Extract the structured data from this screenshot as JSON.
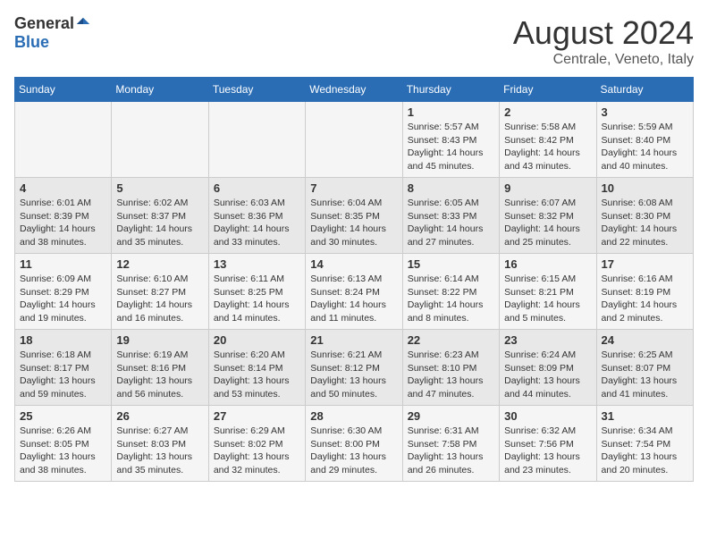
{
  "header": {
    "logo_general": "General",
    "logo_blue": "Blue",
    "month_year": "August 2024",
    "location": "Centrale, Veneto, Italy"
  },
  "calendar": {
    "days_of_week": [
      "Sunday",
      "Monday",
      "Tuesday",
      "Wednesday",
      "Thursday",
      "Friday",
      "Saturday"
    ],
    "weeks": [
      [
        {
          "day": "",
          "info": ""
        },
        {
          "day": "",
          "info": ""
        },
        {
          "day": "",
          "info": ""
        },
        {
          "day": "",
          "info": ""
        },
        {
          "day": "1",
          "info": "Sunrise: 5:57 AM\nSunset: 8:43 PM\nDaylight: 14 hours\nand 45 minutes."
        },
        {
          "day": "2",
          "info": "Sunrise: 5:58 AM\nSunset: 8:42 PM\nDaylight: 14 hours\nand 43 minutes."
        },
        {
          "day": "3",
          "info": "Sunrise: 5:59 AM\nSunset: 8:40 PM\nDaylight: 14 hours\nand 40 minutes."
        }
      ],
      [
        {
          "day": "4",
          "info": "Sunrise: 6:01 AM\nSunset: 8:39 PM\nDaylight: 14 hours\nand 38 minutes."
        },
        {
          "day": "5",
          "info": "Sunrise: 6:02 AM\nSunset: 8:37 PM\nDaylight: 14 hours\nand 35 minutes."
        },
        {
          "day": "6",
          "info": "Sunrise: 6:03 AM\nSunset: 8:36 PM\nDaylight: 14 hours\nand 33 minutes."
        },
        {
          "day": "7",
          "info": "Sunrise: 6:04 AM\nSunset: 8:35 PM\nDaylight: 14 hours\nand 30 minutes."
        },
        {
          "day": "8",
          "info": "Sunrise: 6:05 AM\nSunset: 8:33 PM\nDaylight: 14 hours\nand 27 minutes."
        },
        {
          "day": "9",
          "info": "Sunrise: 6:07 AM\nSunset: 8:32 PM\nDaylight: 14 hours\nand 25 minutes."
        },
        {
          "day": "10",
          "info": "Sunrise: 6:08 AM\nSunset: 8:30 PM\nDaylight: 14 hours\nand 22 minutes."
        }
      ],
      [
        {
          "day": "11",
          "info": "Sunrise: 6:09 AM\nSunset: 8:29 PM\nDaylight: 14 hours\nand 19 minutes."
        },
        {
          "day": "12",
          "info": "Sunrise: 6:10 AM\nSunset: 8:27 PM\nDaylight: 14 hours\nand 16 minutes."
        },
        {
          "day": "13",
          "info": "Sunrise: 6:11 AM\nSunset: 8:25 PM\nDaylight: 14 hours\nand 14 minutes."
        },
        {
          "day": "14",
          "info": "Sunrise: 6:13 AM\nSunset: 8:24 PM\nDaylight: 14 hours\nand 11 minutes."
        },
        {
          "day": "15",
          "info": "Sunrise: 6:14 AM\nSunset: 8:22 PM\nDaylight: 14 hours\nand 8 minutes."
        },
        {
          "day": "16",
          "info": "Sunrise: 6:15 AM\nSunset: 8:21 PM\nDaylight: 14 hours\nand 5 minutes."
        },
        {
          "day": "17",
          "info": "Sunrise: 6:16 AM\nSunset: 8:19 PM\nDaylight: 14 hours\nand 2 minutes."
        }
      ],
      [
        {
          "day": "18",
          "info": "Sunrise: 6:18 AM\nSunset: 8:17 PM\nDaylight: 13 hours\nand 59 minutes."
        },
        {
          "day": "19",
          "info": "Sunrise: 6:19 AM\nSunset: 8:16 PM\nDaylight: 13 hours\nand 56 minutes."
        },
        {
          "day": "20",
          "info": "Sunrise: 6:20 AM\nSunset: 8:14 PM\nDaylight: 13 hours\nand 53 minutes."
        },
        {
          "day": "21",
          "info": "Sunrise: 6:21 AM\nSunset: 8:12 PM\nDaylight: 13 hours\nand 50 minutes."
        },
        {
          "day": "22",
          "info": "Sunrise: 6:23 AM\nSunset: 8:10 PM\nDaylight: 13 hours\nand 47 minutes."
        },
        {
          "day": "23",
          "info": "Sunrise: 6:24 AM\nSunset: 8:09 PM\nDaylight: 13 hours\nand 44 minutes."
        },
        {
          "day": "24",
          "info": "Sunrise: 6:25 AM\nSunset: 8:07 PM\nDaylight: 13 hours\nand 41 minutes."
        }
      ],
      [
        {
          "day": "25",
          "info": "Sunrise: 6:26 AM\nSunset: 8:05 PM\nDaylight: 13 hours\nand 38 minutes."
        },
        {
          "day": "26",
          "info": "Sunrise: 6:27 AM\nSunset: 8:03 PM\nDaylight: 13 hours\nand 35 minutes."
        },
        {
          "day": "27",
          "info": "Sunrise: 6:29 AM\nSunset: 8:02 PM\nDaylight: 13 hours\nand 32 minutes."
        },
        {
          "day": "28",
          "info": "Sunrise: 6:30 AM\nSunset: 8:00 PM\nDaylight: 13 hours\nand 29 minutes."
        },
        {
          "day": "29",
          "info": "Sunrise: 6:31 AM\nSunset: 7:58 PM\nDaylight: 13 hours\nand 26 minutes."
        },
        {
          "day": "30",
          "info": "Sunrise: 6:32 AM\nSunset: 7:56 PM\nDaylight: 13 hours\nand 23 minutes."
        },
        {
          "day": "31",
          "info": "Sunrise: 6:34 AM\nSunset: 7:54 PM\nDaylight: 13 hours\nand 20 minutes."
        }
      ]
    ]
  }
}
